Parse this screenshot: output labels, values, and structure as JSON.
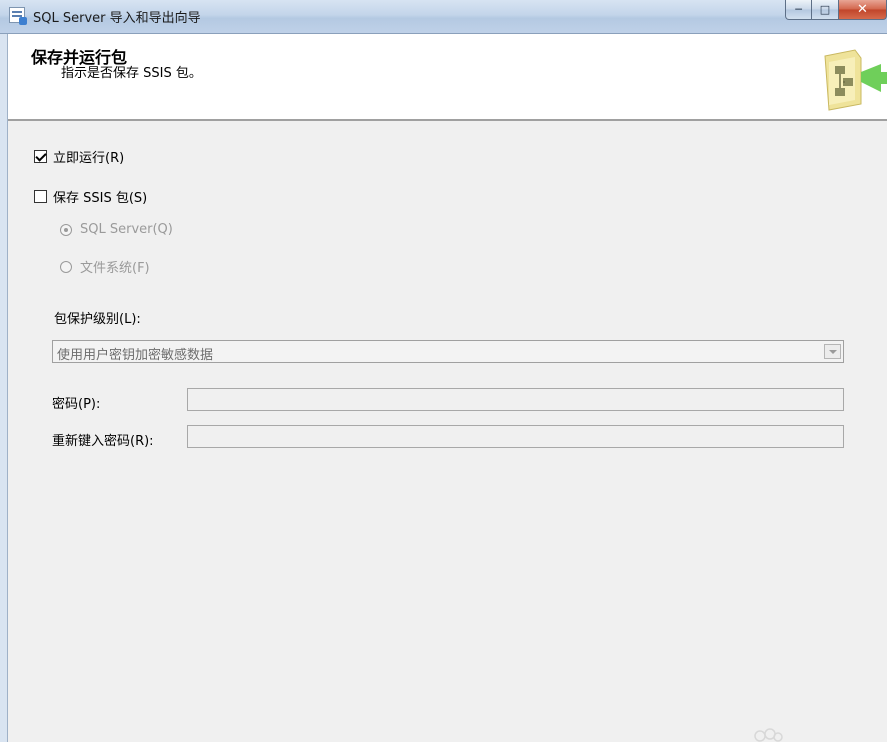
{
  "window": {
    "title": "SQL Server 导入和导出向导",
    "buttons": {
      "minimize": "─",
      "maximize": "□",
      "close": "✕"
    }
  },
  "header": {
    "title": "保存并运行包",
    "subtitle": "指示是否保存 SSIS 包。"
  },
  "options": {
    "run_immediately": {
      "label": "立即运行(R)",
      "checked": true
    },
    "save_ssis": {
      "label": "保存 SSIS 包(S)",
      "checked": false
    },
    "sql_server": {
      "label": "SQL Server(Q)",
      "selected": true,
      "enabled": false
    },
    "file_system": {
      "label": "文件系统(F)",
      "selected": false,
      "enabled": false
    }
  },
  "protection": {
    "label": "包保护级别(L):",
    "value": "使用用户密钥加密敏感数据"
  },
  "password": {
    "label": "密码(P):",
    "value": ""
  },
  "password_confirm": {
    "label": "重新键入密码(R):",
    "value": ""
  },
  "colors": {
    "title_bar": "#c3d5ea",
    "close_button": "#c0442a",
    "disabled_text": "#9a9a9a",
    "background": "#f0f0f0"
  }
}
